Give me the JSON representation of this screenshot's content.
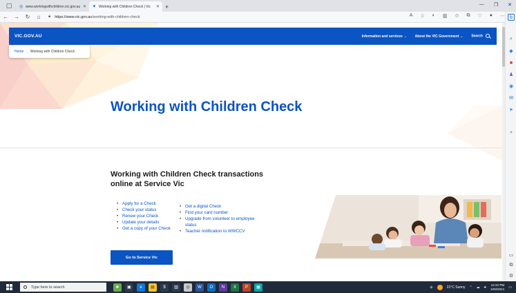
{
  "browser": {
    "tabs": [
      {
        "label": "www.workingwithchildren.vic.gov.au",
        "active": false
      },
      {
        "label": "Working with Children Check | Vic",
        "active": true
      }
    ],
    "url_host": "https://www.vic.gov.au",
    "url_path": "/working-with-children-check"
  },
  "site": {
    "logo": "VIC.GOV.AU",
    "nav": [
      "Information and services",
      "About the VIC Government"
    ],
    "search_label": "Search"
  },
  "breadcrumb": {
    "home": "Home",
    "current": "Working with Children Check"
  },
  "page": {
    "title": "Working with Children Check",
    "section_title": "Working with Children Check transactions online at Service Vic",
    "links_left": [
      "Apply for a Check",
      "Check your status",
      "Renew your Check",
      "Update your details",
      "Get a copy of your Check"
    ],
    "links_right": [
      "Get a digital Check",
      "Find your card number",
      "Upgrade from volunteer to employee status",
      "Teacher notification to WWCCV"
    ],
    "cta": "Go to Service Vic"
  },
  "taskbar": {
    "search_placeholder": "Type here to search",
    "weather": "21°C  Sunny",
    "time": "12:22 PM",
    "date": "1/08/2021"
  },
  "colors": {
    "brand_blue": "#0b54c3",
    "taskbar": "#1f2a3a"
  }
}
